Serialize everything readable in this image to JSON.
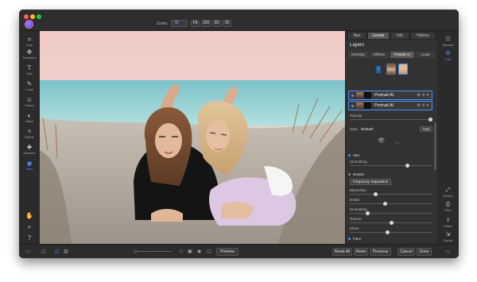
{
  "toolbar": {
    "zoom_label": "Zoom:",
    "zoom_value": "30",
    "zoom_buttons": [
      "Fit",
      "100",
      "50",
      "25"
    ]
  },
  "left_tools": [
    {
      "label": "Crop",
      "icon": "crop-icon"
    },
    {
      "label": "Transform",
      "icon": "transform-icon"
    },
    {
      "label": "Text",
      "icon": "text-icon"
    },
    {
      "label": "Local",
      "icon": "local-icon"
    },
    {
      "label": "Faces",
      "icon": "faces-icon"
    },
    {
      "label": "Mask",
      "icon": "mask-icon"
    },
    {
      "label": "Refine",
      "icon": "refine-icon"
    },
    {
      "label": "Retouch",
      "icon": "retouch-icon"
    },
    {
      "label": "View",
      "icon": "view-icon"
    }
  ],
  "panel": {
    "tabs": [
      "Nav",
      "Levels",
      "Info",
      "History"
    ],
    "active_tab": "Levels",
    "layers_title": "Layers",
    "sub_tabs": [
      "Develop",
      "Effects",
      "Portrait AI",
      "Local"
    ],
    "active_sub_tab": "Portrait AI",
    "layers": [
      {
        "name": "Portrait AI"
      },
      {
        "name": "Portrait AI"
      }
    ],
    "opacity_label": "Opacity",
    "style_label": "Style",
    "style_value": "Default*",
    "auto_button": "Auto",
    "sections": {
      "skin": "Skin",
      "details": "Details"
    },
    "smoothing_label": "Smoothing",
    "dropdown_value": "Frequency Separation",
    "sliders": [
      {
        "label": "Blemishes",
        "value": 30
      },
      {
        "label": "Detail",
        "value": 42
      },
      {
        "label": "Smoothing",
        "value": 20
      },
      {
        "label": "Texture",
        "value": 50
      },
      {
        "label": "Shine",
        "value": 45
      }
    ],
    "face_label": "Face"
  },
  "right_tools": [
    {
      "label": "Browse",
      "icon": "browse-icon"
    },
    {
      "label": "Edit",
      "icon": "edit-icon"
    },
    {
      "label": "Resize",
      "icon": "resize-icon"
    },
    {
      "label": "Print",
      "icon": "print-icon"
    },
    {
      "label": "Share",
      "icon": "share-icon"
    },
    {
      "label": "Export",
      "icon": "export-icon"
    }
  ],
  "bottom": {
    "preview": "Preview",
    "reset_all": "Reset All",
    "reset": "Reset",
    "previous": "Previous",
    "cancel": "Cancel",
    "done": "Done"
  }
}
